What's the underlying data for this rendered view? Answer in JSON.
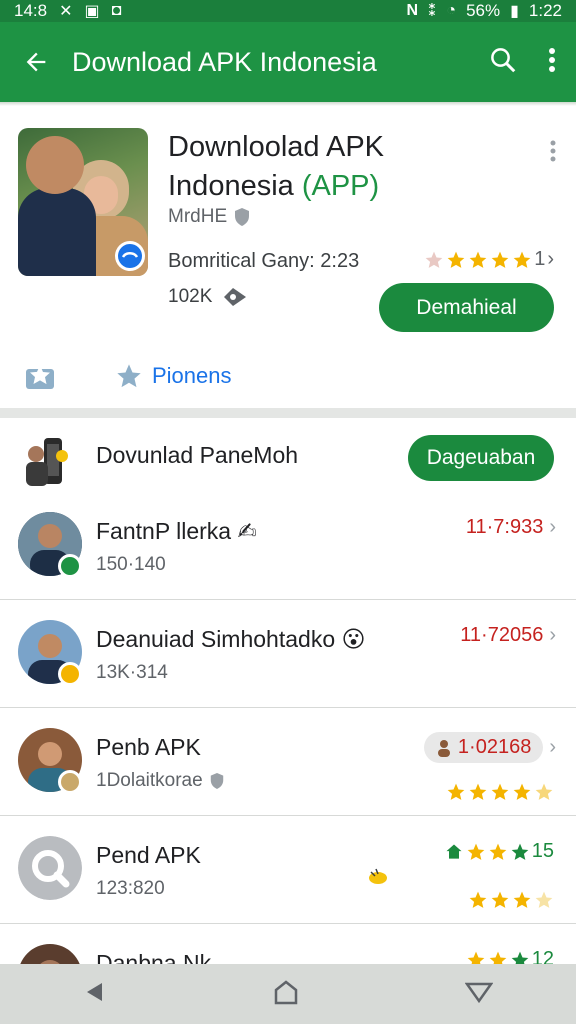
{
  "status_bar": {
    "left_text": "14:8",
    "battery": "56%",
    "time": "1:22"
  },
  "app_bar": {
    "title": "Download APK Indonesia",
    "back_icon": "arrow-back-icon",
    "search_icon": "search-icon",
    "more_icon": "more-vert-icon"
  },
  "hero": {
    "title_line1": "Downloolad APK",
    "title_line2_prefix": "Indonesia ",
    "title_line2_accent": "(APP)",
    "developer": "MrdHE",
    "meta": "Bomritical Gany: 2:23",
    "rating_suffix": "1",
    "size": "102K",
    "install_label": "Demahieal",
    "pioneers_label": "Pionens",
    "rating_stars": 4
  },
  "download_row": {
    "label": "Dovunlad PaneMoh",
    "button_label": "Dageuaban"
  },
  "list": [
    {
      "name": "FantnP  llerka",
      "emoji": "✍",
      "sub": "150·140",
      "right_text": "11·7:933"
    },
    {
      "name": "Deanuiad Simhohtadko",
      "emoji": "😮",
      "sub": "13K·314",
      "right_text": "11·72056"
    },
    {
      "name": "Penb APK",
      "sub": "1Dolaitkorae",
      "right_text": "1·02168"
    },
    {
      "name": "Pend APK",
      "sub": "123:820",
      "right_text": "15"
    },
    {
      "name": "Danbna Nk",
      "right_text": "12"
    }
  ],
  "colors": {
    "status_bar": "#1b7f3c",
    "app_bar": "#1e9344",
    "accent_green": "#1b8a3e",
    "star_gold": "#f4b400",
    "red_text": "#c5221f",
    "link_blue": "#1a73e8"
  }
}
